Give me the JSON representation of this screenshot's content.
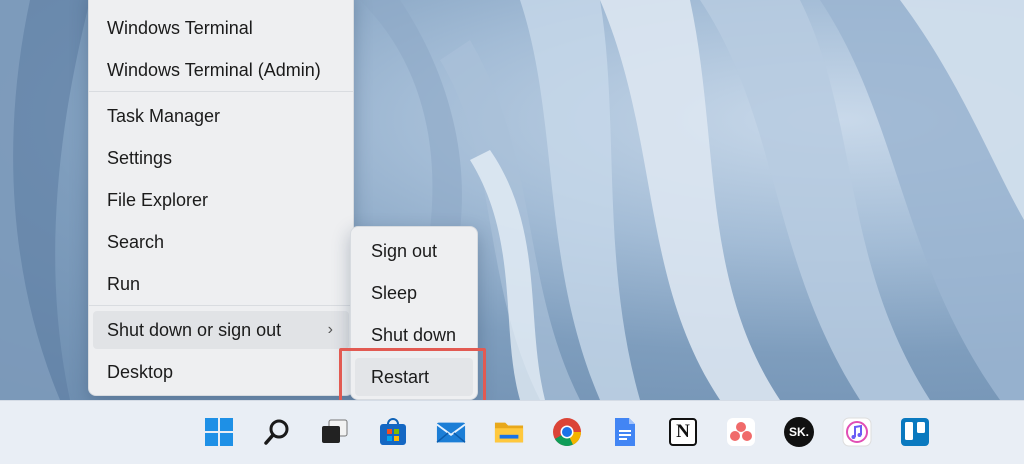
{
  "context_menu": {
    "items": [
      {
        "label": "Windows Terminal"
      },
      {
        "label": "Windows Terminal (Admin)"
      },
      {
        "label": "Task Manager"
      },
      {
        "label": "Settings"
      },
      {
        "label": "File Explorer"
      },
      {
        "label": "Search"
      },
      {
        "label": "Run"
      },
      {
        "label": "Shut down or sign out",
        "has_submenu": true,
        "highlighted": true
      },
      {
        "label": "Desktop"
      }
    ],
    "submenu_arrow": "›"
  },
  "submenu": {
    "items": [
      {
        "label": "Sign out"
      },
      {
        "label": "Sleep"
      },
      {
        "label": "Shut down"
      },
      {
        "label": "Restart",
        "highlighted": true
      }
    ],
    "callout_color": "#e25a52"
  },
  "taskbar": {
    "icons": [
      "windows-start-icon",
      "search-icon",
      "task-view-icon",
      "microsoft-store-icon",
      "mail-icon",
      "file-explorer-icon",
      "chrome-icon",
      "google-docs-icon",
      "notion-icon",
      "asana-icon",
      "sk-icon",
      "itunes-icon",
      "trello-icon"
    ],
    "sk_label": "SK.",
    "notion_label": "N"
  },
  "colors": {
    "accent_blue": "#1a73e8",
    "taskbar_bg": "#e9eef5",
    "menu_bg": "#eeeff1"
  }
}
